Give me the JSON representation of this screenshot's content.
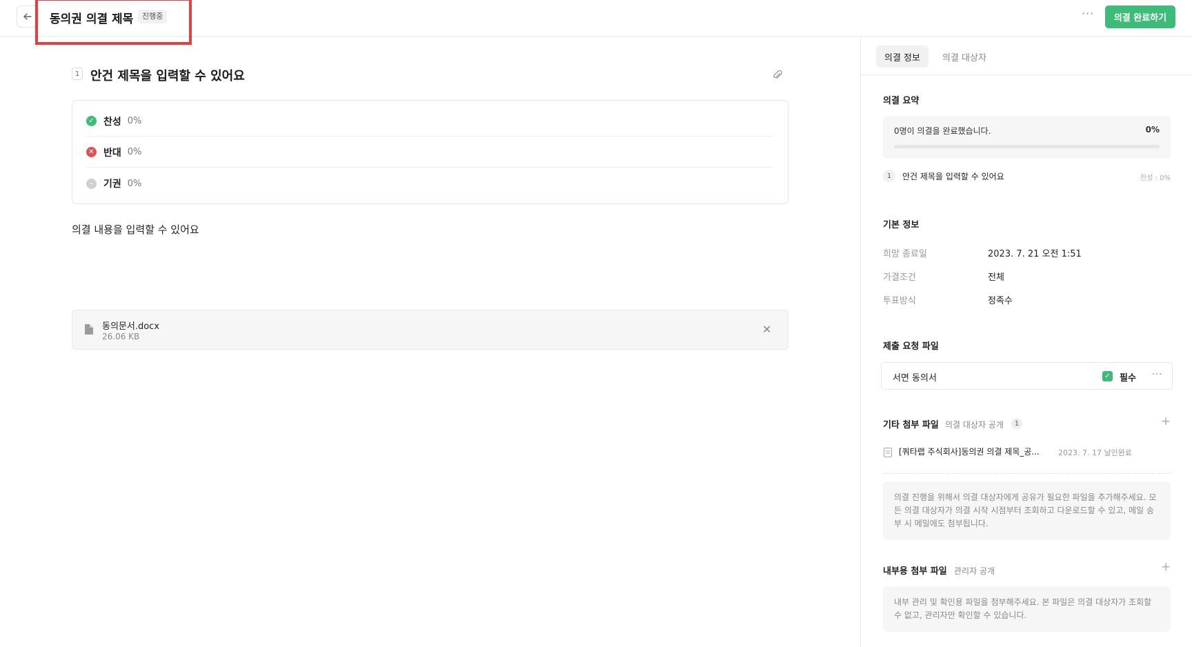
{
  "header": {
    "title": "동의권 의결 제목",
    "status": "진행중",
    "complete_button": "의결 완료하기"
  },
  "agenda": {
    "number": "1",
    "title": "안건 제목을 입력할 수 있어요",
    "options": [
      {
        "label": "찬성",
        "percent": "0%"
      },
      {
        "label": "반대",
        "percent": "0%"
      },
      {
        "label": "기권",
        "percent": "0%"
      }
    ],
    "content": "의결 내용을 입력할 수 있어요",
    "attachment": {
      "name": "동의문서.docx",
      "size": "26.06 KB"
    }
  },
  "side": {
    "tabs": [
      "의결 정보",
      "의결 대상자"
    ],
    "summary": {
      "heading": "의결 요약",
      "text": "0명이 의결을 완료했습니다.",
      "percent": "0%",
      "progress": 0,
      "item_number": "1",
      "item_title": "안건 제목을 입력할 수 있어요",
      "item_stat": "찬성 : 0%"
    },
    "basic": {
      "heading": "기본 정보",
      "rows": [
        {
          "label": "희망 종료일",
          "value": "2023. 7. 21 오전 1:51"
        },
        {
          "label": "가결조건",
          "value": "전체"
        },
        {
          "label": "투표방식",
          "value": "정족수"
        }
      ]
    },
    "required": {
      "heading": "제출 요청 파일",
      "file_name": "서면 동의서",
      "required_label": "필수"
    },
    "other": {
      "heading": "기타 첨부 파일",
      "note": "의결 대상자 공개",
      "count": "1",
      "file_name": "[쿼타랩 주식회사]동의권 의결 제목_공...",
      "file_meta": "2023. 7. 17 날인완료",
      "help": "의결 진행을 위해서 의결 대상자에게 공유가 필요한 파일을 추가해주세요. 모든 의결 대상자가 의결 시작 시점부터 조회하고 다운로드할 수 있고, 메일 송부 시 메일에도 첨부됩니다."
    },
    "internal": {
      "heading": "내부용 첨부 파일",
      "note": "관리자 공개",
      "help": "내부 관리 및 확인용 파일을 첨부해주세요. 본 파일은 의결 대상자가 조회할 수 없고, 관리자만 확인할 수 있습니다."
    }
  },
  "colors": {
    "accent": "#3dbb79",
    "danger": "#e05252",
    "neutral": "#c9c9c9",
    "highlight": "#e53e3e"
  },
  "icons": [
    "back-arrow-icon",
    "more-icon",
    "paperclip-icon",
    "check-circle-icon",
    "x-circle-icon",
    "abstain-icon",
    "document-icon",
    "close-icon",
    "checkbox-icon",
    "plus-icon"
  ]
}
